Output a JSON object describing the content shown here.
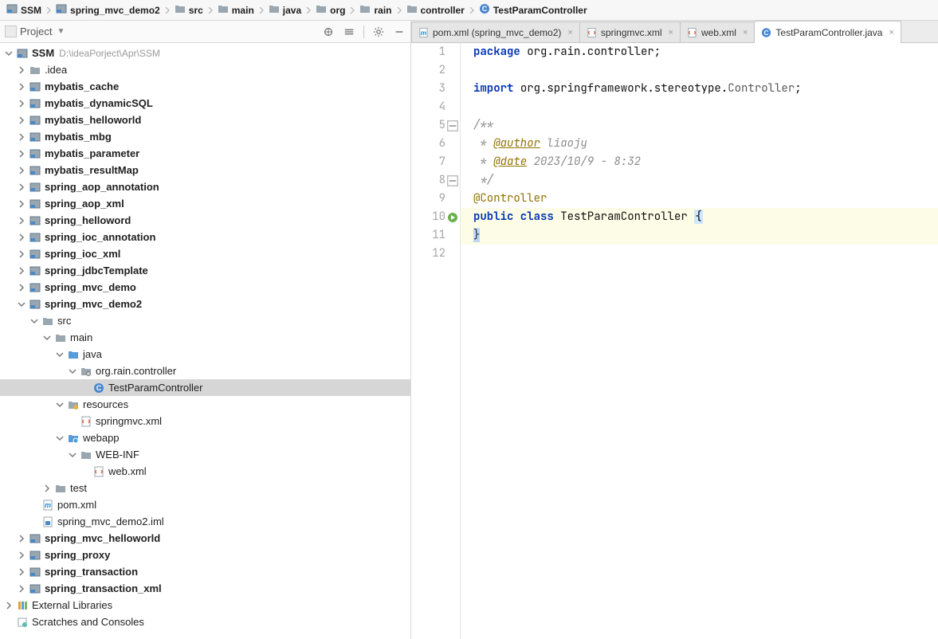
{
  "breadcrumb": {
    "items": [
      {
        "label": "SSM",
        "icon": "module"
      },
      {
        "label": "spring_mvc_demo2",
        "icon": "module"
      },
      {
        "label": "src",
        "icon": "folder"
      },
      {
        "label": "main",
        "icon": "folder"
      },
      {
        "label": "java",
        "icon": "folder"
      },
      {
        "label": "org",
        "icon": "folder"
      },
      {
        "label": "rain",
        "icon": "folder"
      },
      {
        "label": "controller",
        "icon": "folder"
      },
      {
        "label": "TestParamController",
        "icon": "class"
      }
    ]
  },
  "sidebar": {
    "title": "Project",
    "root_path": "D:\\ideaPorject\\Apr\\SSM",
    "tree": [
      {
        "depth": 0,
        "exp": "open",
        "icon": "module",
        "label": "SSM",
        "bold": true,
        "trail": "D:\\ideaPorject\\Apr\\SSM"
      },
      {
        "depth": 1,
        "exp": "closed",
        "icon": "folder",
        "label": ".idea"
      },
      {
        "depth": 1,
        "exp": "closed",
        "icon": "module",
        "label": "mybatis_cache",
        "bold": true
      },
      {
        "depth": 1,
        "exp": "closed",
        "icon": "module",
        "label": "mybatis_dynamicSQL",
        "bold": true
      },
      {
        "depth": 1,
        "exp": "closed",
        "icon": "module",
        "label": "mybatis_helloworld",
        "bold": true
      },
      {
        "depth": 1,
        "exp": "closed",
        "icon": "module",
        "label": "mybatis_mbg",
        "bold": true
      },
      {
        "depth": 1,
        "exp": "closed",
        "icon": "module",
        "label": "mybatis_parameter",
        "bold": true
      },
      {
        "depth": 1,
        "exp": "closed",
        "icon": "module",
        "label": "mybatis_resultMap",
        "bold": true
      },
      {
        "depth": 1,
        "exp": "closed",
        "icon": "module",
        "label": "spring_aop_annotation",
        "bold": true
      },
      {
        "depth": 1,
        "exp": "closed",
        "icon": "module",
        "label": "spring_aop_xml",
        "bold": true
      },
      {
        "depth": 1,
        "exp": "closed",
        "icon": "module",
        "label": "spring_helloword",
        "bold": true
      },
      {
        "depth": 1,
        "exp": "closed",
        "icon": "module",
        "label": "spring_ioc_annotation",
        "bold": true
      },
      {
        "depth": 1,
        "exp": "closed",
        "icon": "module",
        "label": "spring_ioc_xml",
        "bold": true
      },
      {
        "depth": 1,
        "exp": "closed",
        "icon": "module",
        "label": "spring_jdbcTemplate",
        "bold": true
      },
      {
        "depth": 1,
        "exp": "closed",
        "icon": "module",
        "label": "spring_mvc_demo",
        "bold": true
      },
      {
        "depth": 1,
        "exp": "open",
        "icon": "module",
        "label": "spring_mvc_demo2",
        "bold": true
      },
      {
        "depth": 2,
        "exp": "open",
        "icon": "folder",
        "label": "src"
      },
      {
        "depth": 3,
        "exp": "open",
        "icon": "folder",
        "label": "main"
      },
      {
        "depth": 4,
        "exp": "open",
        "icon": "src-folder",
        "label": "java"
      },
      {
        "depth": 5,
        "exp": "open",
        "icon": "package",
        "label": "org.rain.controller"
      },
      {
        "depth": 6,
        "exp": "none",
        "icon": "class",
        "label": "TestParamController",
        "selected": true
      },
      {
        "depth": 4,
        "exp": "open",
        "icon": "res-folder",
        "label": "resources"
      },
      {
        "depth": 5,
        "exp": "none",
        "icon": "xml",
        "label": "springmvc.xml"
      },
      {
        "depth": 4,
        "exp": "open",
        "icon": "web-folder",
        "label": "webapp"
      },
      {
        "depth": 5,
        "exp": "open",
        "icon": "folder",
        "label": "WEB-INF"
      },
      {
        "depth": 6,
        "exp": "none",
        "icon": "xml",
        "label": "web.xml"
      },
      {
        "depth": 3,
        "exp": "closed",
        "icon": "folder",
        "label": "test"
      },
      {
        "depth": 2,
        "exp": "none",
        "icon": "maven",
        "label": "pom.xml"
      },
      {
        "depth": 2,
        "exp": "none",
        "icon": "iml",
        "label": "spring_mvc_demo2.iml"
      },
      {
        "depth": 1,
        "exp": "closed",
        "icon": "module",
        "label": "spring_mvc_helloworld",
        "bold": true
      },
      {
        "depth": 1,
        "exp": "closed",
        "icon": "module",
        "label": "spring_proxy",
        "bold": true
      },
      {
        "depth": 1,
        "exp": "closed",
        "icon": "module",
        "label": "spring_transaction",
        "bold": true
      },
      {
        "depth": 1,
        "exp": "closed",
        "icon": "module",
        "label": "spring_transaction_xml",
        "bold": true
      },
      {
        "depth": 0,
        "exp": "closed",
        "icon": "libs",
        "label": "External Libraries"
      },
      {
        "depth": 0,
        "exp": "none",
        "icon": "scratches",
        "label": "Scratches and Consoles"
      }
    ]
  },
  "tabs": [
    {
      "label": "pom.xml (spring_mvc_demo2)",
      "icon": "maven",
      "active": false
    },
    {
      "label": "springmvc.xml",
      "icon": "xml",
      "active": false
    },
    {
      "label": "web.xml",
      "icon": "xml",
      "active": false
    },
    {
      "label": "TestParamController.java",
      "icon": "class",
      "active": true
    }
  ],
  "code": {
    "lines": [
      {
        "n": 1,
        "segs": [
          {
            "t": "package ",
            "c": "kw"
          },
          {
            "t": "org.rain.controller;",
            "c": "plain"
          }
        ]
      },
      {
        "n": 2,
        "segs": []
      },
      {
        "n": 3,
        "segs": [
          {
            "t": "import ",
            "c": "kw"
          },
          {
            "t": "org.springframework.stereotype.",
            "c": "plain"
          },
          {
            "t": "Controller",
            "c": "cls"
          },
          {
            "t": ";",
            "c": "plain"
          }
        ]
      },
      {
        "n": 4,
        "segs": []
      },
      {
        "n": 5,
        "segs": [
          {
            "t": "/**",
            "c": "doc"
          }
        ],
        "fold": "open"
      },
      {
        "n": 6,
        "segs": [
          {
            "t": " * ",
            "c": "doc"
          },
          {
            "t": "@author",
            "c": "ann-u"
          },
          {
            "t": " liaojy",
            "c": "doc-it"
          }
        ]
      },
      {
        "n": 7,
        "segs": [
          {
            "t": " * ",
            "c": "doc"
          },
          {
            "t": "@date",
            "c": "ann-u"
          },
          {
            "t": " 2023/10/9 - 8:32",
            "c": "doc-it"
          }
        ]
      },
      {
        "n": 8,
        "segs": [
          {
            "t": " */",
            "c": "doc"
          }
        ],
        "fold": "close"
      },
      {
        "n": 9,
        "segs": [
          {
            "t": "@Controller",
            "c": "ann"
          }
        ]
      },
      {
        "n": 10,
        "segs": [
          {
            "t": "public class ",
            "c": "kw"
          },
          {
            "t": "TestParamController ",
            "c": "plain"
          },
          {
            "t": "{",
            "c": "brace"
          }
        ],
        "mark": "run",
        "hl": true
      },
      {
        "n": 11,
        "segs": [
          {
            "t": "}",
            "c": "caretbg"
          }
        ],
        "hl": true
      },
      {
        "n": 12,
        "segs": []
      }
    ]
  }
}
